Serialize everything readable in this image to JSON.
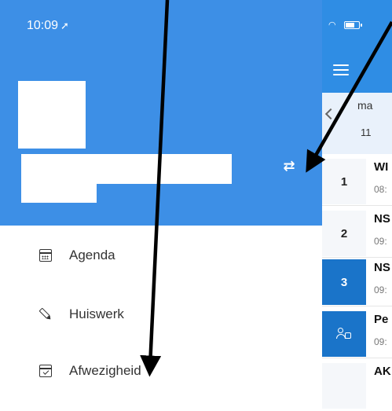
{
  "status_bar": {
    "time": "10:09",
    "location_glyph": "➚"
  },
  "drawer": {
    "switch_icon": "switch-account-icon",
    "menu": [
      {
        "label": "Agenda",
        "icon": "calendar-icon"
      },
      {
        "label": "Huiswerk",
        "icon": "pencil-icon"
      },
      {
        "label": "Afwezigheid",
        "icon": "calendar-check-icon"
      }
    ],
    "colors": {
      "header": "#3d8fe6",
      "app_header": "#2f8de4",
      "active_lesson": "#1a74c9"
    }
  },
  "schedule": {
    "day_name": "ma",
    "day_number": "11",
    "lessons": [
      {
        "number": "1",
        "title": "WI",
        "time": "08:",
        "active": false
      },
      {
        "number": "2",
        "title": "NS",
        "time": "09:",
        "active": false
      },
      {
        "number": "3",
        "title": "NS",
        "time": "09:",
        "active": true
      },
      {
        "number": "",
        "title": "Pe",
        "time": "09:",
        "active": true,
        "icon": "person-lock-icon"
      },
      {
        "number": "",
        "title": "AK",
        "time": "",
        "active": false
      }
    ]
  }
}
